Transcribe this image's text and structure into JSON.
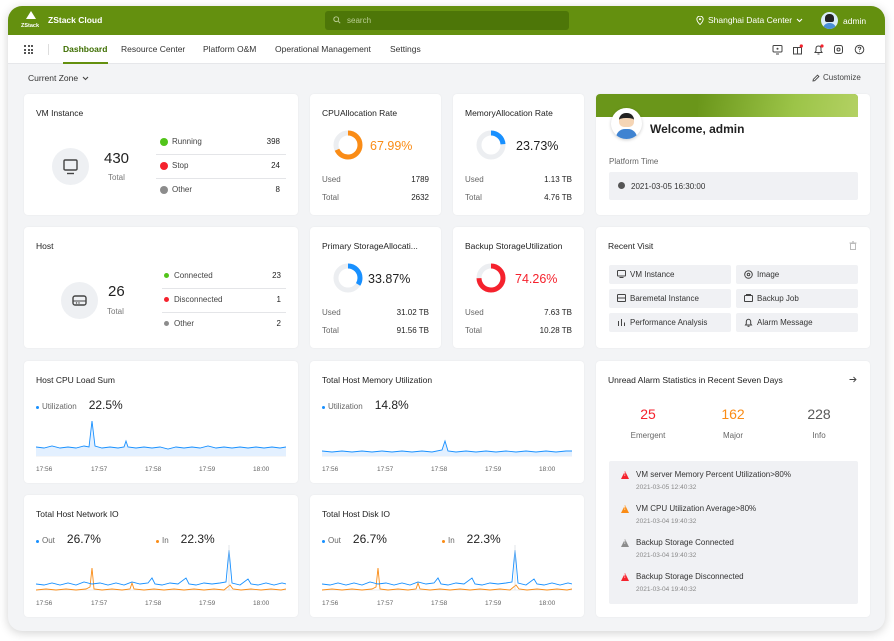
{
  "app": {
    "brand": "ZStack",
    "title": "ZStack Cloud",
    "search_placeholder": "search",
    "data_center": "Shanghai Data Center",
    "user": "admin"
  },
  "nav": {
    "items": [
      {
        "label": "Dashboard",
        "active": true
      },
      {
        "label": "Resource Center"
      },
      {
        "label": "Platform O&M"
      },
      {
        "label": "Operational Management"
      },
      {
        "label": "Settings"
      }
    ]
  },
  "toolbar": {
    "zone": "Current Zone",
    "customize": "Customize"
  },
  "vm": {
    "title": "VM Instance",
    "total": "430",
    "total_label": "Total",
    "icon": "monitor-icon",
    "rows": [
      {
        "label": "Running",
        "value": "398",
        "color": "#52c41a"
      },
      {
        "label": "Stop",
        "value": "24",
        "color": "#f5222d"
      },
      {
        "label": "Other",
        "value": "8",
        "color": "#8c8c8c"
      }
    ]
  },
  "host": {
    "title": "Host",
    "total": "26",
    "total_label": "Total",
    "icon": "server-icon",
    "rows": [
      {
        "label": "Connected",
        "value": "23",
        "color": "#52c41a"
      },
      {
        "label": "Disconnected",
        "value": "1",
        "color": "#f5222d"
      },
      {
        "label": "Other",
        "value": "2",
        "color": "#8c8c8c"
      }
    ]
  },
  "cpu_alloc": {
    "title": "CPUAllocation Rate",
    "percent": "67.99%",
    "fraction": 0.6799,
    "color": "#fa8c16",
    "used_label": "Used",
    "used": "1789",
    "total_label": "Total",
    "total": "2632"
  },
  "mem_alloc": {
    "title": "MemoryAllocation Rate",
    "percent": "23.73%",
    "fraction": 0.2373,
    "color": "#1890ff",
    "used_label": "Used",
    "used": "1.13 TB",
    "total_label": "Total",
    "total": "4.76 TB"
  },
  "primary_storage": {
    "title": "Primary StorageAllocati...",
    "percent": "33.87%",
    "fraction": 0.3387,
    "color": "#1890ff",
    "used_label": "Used",
    "used": "31.02 TB",
    "total_label": "Total",
    "total": "91.56 TB"
  },
  "backup_storage": {
    "title": "Backup StorageUtilization",
    "percent": "74.26%",
    "fraction": 0.7426,
    "color": "#f5222d",
    "used_label": "Used",
    "used": "7.63 TB",
    "total_label": "Total",
    "total": "10.28 TB"
  },
  "welcome": {
    "text": "Welcome, admin",
    "platform_time_label": "Platform Time",
    "platform_time": "2021-03-05 16:30:00"
  },
  "recent": {
    "title": "Recent Visit",
    "items": [
      {
        "label": "VM Instance",
        "icon": "monitor-icon"
      },
      {
        "label": "Image",
        "icon": "disc-icon"
      },
      {
        "label": "Baremetal Instance",
        "icon": "baremetal-icon"
      },
      {
        "label": "Backup Job",
        "icon": "backup-icon"
      },
      {
        "label": "Performance Analysis",
        "icon": "bar-chart-icon"
      },
      {
        "label": "Alarm Message",
        "icon": "bell-icon"
      }
    ]
  },
  "cpu_load": {
    "title": "Host CPU Load Sum",
    "legend": "Utilization",
    "value": "22.5%",
    "color": "#1890ff",
    "ticks": [
      "17:56",
      "17:57",
      "17:58",
      "17:59",
      "18:00"
    ]
  },
  "mem_util": {
    "title": "Total Host Memory Utilization",
    "legend": "Utilization",
    "value": "14.8%",
    "color": "#1890ff",
    "ticks": [
      "17:56",
      "17:57",
      "17:58",
      "17:59",
      "18:00"
    ]
  },
  "net_io": {
    "title": "Total Host Network IO",
    "out_label": "Out",
    "out_value": "26.7%",
    "in_label": "In",
    "in_value": "22.3%",
    "out_color": "#1890ff",
    "in_color": "#fa8c16",
    "ticks": [
      "17:56",
      "17:57",
      "17:58",
      "17:59",
      "18:00"
    ]
  },
  "disk_io": {
    "title": "Total Host Disk IO",
    "out_label": "Out",
    "out_value": "26.7%",
    "in_label": "In",
    "in_value": "22.3%",
    "out_color": "#1890ff",
    "in_color": "#fa8c16",
    "ticks": [
      "17:56",
      "17:57",
      "17:58",
      "17:59",
      "18:00"
    ]
  },
  "alarms": {
    "title": "Unread Alarm Statistics in Recent Seven Days",
    "stats": [
      {
        "value": "25",
        "label": "Emergent",
        "color": "#f5222d"
      },
      {
        "value": "162",
        "label": "Major",
        "color": "#fa8c16"
      },
      {
        "value": "228",
        "label": "Info",
        "color": "#595959"
      }
    ],
    "items": [
      {
        "text": "VM server Memory Percent Utilization>80%",
        "time": "2021-03-05 12:40:32",
        "color": "#f5222d"
      },
      {
        "text": "VM CPU Utilization Average>80%",
        "time": "2021-03-04 19:40:32",
        "color": "#fa8c16"
      },
      {
        "text": "Backup Storage Connected",
        "time": "2021-03-04 19:40:32",
        "color": "#8c8c8c"
      },
      {
        "text": "Backup Storage Disconnected",
        "time": "2021-03-04 19:40:32",
        "color": "#f5222d"
      }
    ]
  }
}
